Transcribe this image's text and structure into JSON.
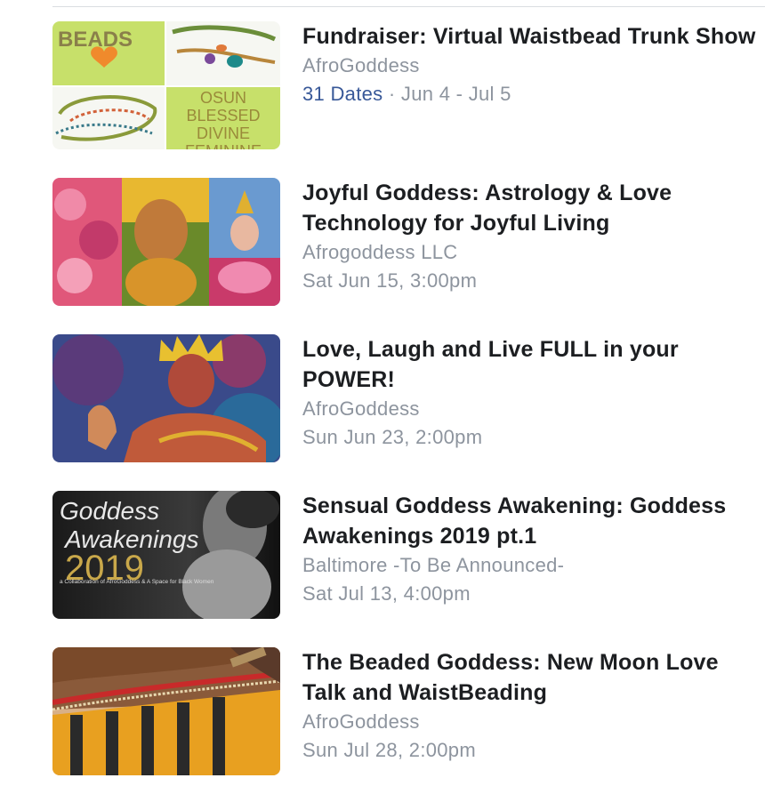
{
  "events": [
    {
      "title": "Fundraiser: Virtual Waistbead Trunk Show",
      "host": "AfroGoddess",
      "dates_link": "31 Dates",
      "separator": " · ",
      "when": "Jun 4 - Jul 5",
      "thumbnail": {
        "beads_text": "BEADS",
        "line1": "OSUN",
        "line2": "BLESSED",
        "line3": "DIVINE",
        "line4": "FEMININE"
      }
    },
    {
      "title": "Joyful Goddess: Astrology & Love Technology for Joyful Living",
      "host": "Afrogoddess LLC",
      "when": "Sat Jun 15, 3:00pm"
    },
    {
      "title": "Love, Laugh and Live FULL in your POWER!",
      "host": "AfroGoddess",
      "when": "Sun Jun 23, 2:00pm"
    },
    {
      "title": "Sensual Goddess Awakening: Goddess Awakenings 2019 pt.1",
      "host": "Baltimore -To Be Announced-",
      "when": "Sat Jul 13, 4:00pm",
      "thumbnail": {
        "line1": "Goddess",
        "line2": "Awakenings",
        "year": "2019",
        "caption": "a Collaboration of AfroGoddess & A Space for Black Women"
      }
    },
    {
      "title": "The Beaded Goddess: New Moon Love Talk and WaistBeading",
      "host": "AfroGoddess",
      "when": "Sun Jul 28, 2:00pm"
    }
  ]
}
